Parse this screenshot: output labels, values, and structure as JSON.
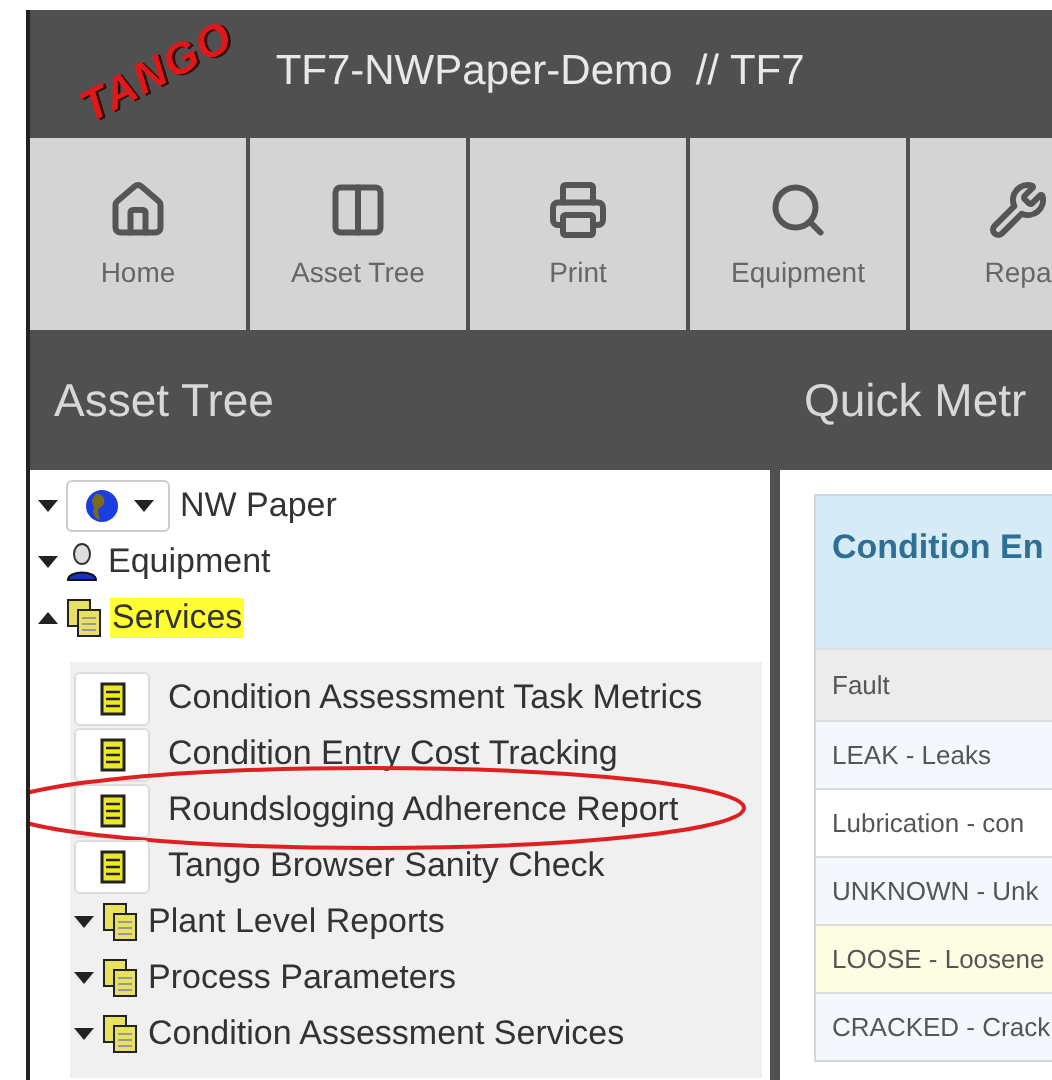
{
  "logo": "TANGO",
  "window": {
    "title": "TF7-NWPaper-Demo  // TF7"
  },
  "toolbar": [
    {
      "label": "Home",
      "kind": "home"
    },
    {
      "label": "Asset Tree",
      "kind": "tree"
    },
    {
      "label": "Print",
      "kind": "print"
    },
    {
      "label": "Equipment",
      "kind": "equipment"
    },
    {
      "label": "Repa",
      "kind": "repair"
    }
  ],
  "sidebar": {
    "title": "Asset Tree",
    "tree": [
      {
        "label": "NW Paper",
        "kind": "site",
        "expanded": false,
        "selected": false
      },
      {
        "label": "Equipment",
        "kind": "person",
        "expanded": false,
        "selected": false
      },
      {
        "label": "Services",
        "kind": "folder",
        "expanded": true,
        "selected": true,
        "children": [
          {
            "label": "Condition Assessment Task Metrics",
            "kind": "report",
            "circled": false
          },
          {
            "label": "Condition Entry Cost Tracking",
            "kind": "report",
            "circled": false
          },
          {
            "label": "Roundslogging Adherence Report",
            "kind": "report",
            "circled": true
          },
          {
            "label": "Tango Browser Sanity Check",
            "kind": "report",
            "circled": false
          },
          {
            "label": "Plant Level Reports",
            "kind": "folder",
            "expanded": false,
            "circled": false
          },
          {
            "label": "Process Parameters",
            "kind": "folder",
            "expanded": false,
            "circled": false
          },
          {
            "label": "Condition Assessment Services",
            "kind": "folder",
            "expanded": false,
            "circled": false
          }
        ]
      }
    ]
  },
  "main": {
    "title": "Quick Metr",
    "card": {
      "title": "Condition En",
      "table": {
        "columns": [
          "Fault"
        ],
        "rows": [
          {
            "cells": [
              "LEAK - Leaks"
            ],
            "highlighted": false
          },
          {
            "cells": [
              "Lubrication - con"
            ],
            "highlighted": false
          },
          {
            "cells": [
              "UNKNOWN - Unk"
            ],
            "highlighted": false
          },
          {
            "cells": [
              "LOOSE - Loosene"
            ],
            "highlighted": true
          },
          {
            "cells": [
              "CRACKED - Crack"
            ],
            "highlighted": false
          }
        ]
      }
    }
  }
}
